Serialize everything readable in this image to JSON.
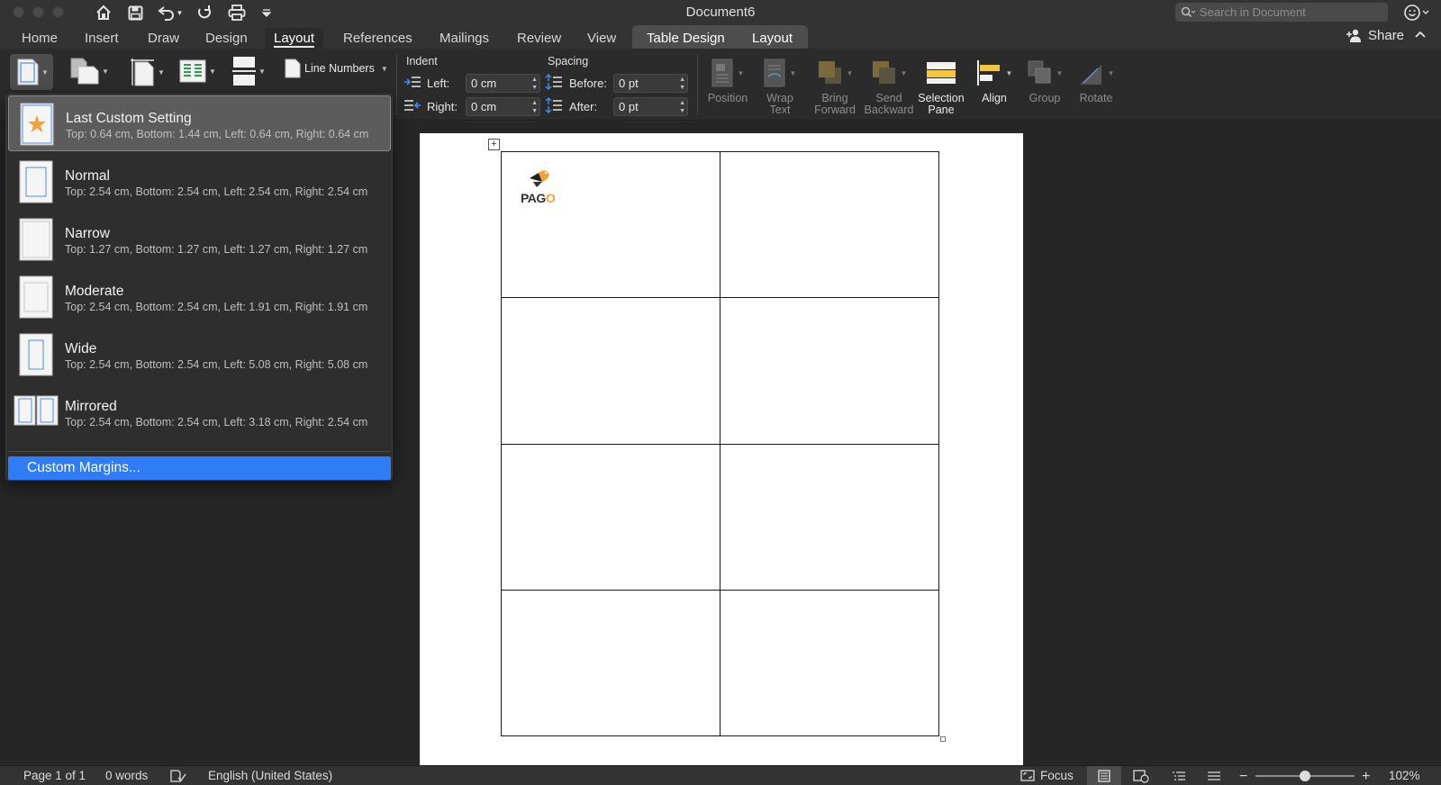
{
  "window": {
    "title": "Document6"
  },
  "search": {
    "placeholder": "Search in Document"
  },
  "tabs": [
    {
      "label": "Home"
    },
    {
      "label": "Insert"
    },
    {
      "label": "Draw"
    },
    {
      "label": "Design"
    },
    {
      "label": "Layout"
    },
    {
      "label": "References"
    },
    {
      "label": "Mailings"
    },
    {
      "label": "Review"
    },
    {
      "label": "View"
    },
    {
      "label": "Table Design"
    },
    {
      "label": "Layout"
    }
  ],
  "share": {
    "label": "Share"
  },
  "ribbon": {
    "line_numbers": "Line Numbers",
    "indent": {
      "title": "Indent",
      "left_label": "Left:",
      "left_value": "0 cm",
      "right_label": "Right:",
      "right_value": "0 cm"
    },
    "spacing": {
      "title": "Spacing",
      "before_label": "Before:",
      "before_value": "0 pt",
      "after_label": "After:",
      "after_value": "0 pt"
    },
    "arrange": {
      "position": "Position",
      "wrap_1": "Wrap",
      "wrap_2": "Text",
      "bring_1": "Bring",
      "bring_2": "Forward",
      "send_1": "Send",
      "send_2": "Backward",
      "sel_1": "Selection",
      "sel_2": "Pane",
      "align": "Align",
      "group": "Group",
      "rotate": "Rotate"
    }
  },
  "margins_menu": {
    "options": [
      {
        "name": "Last Custom Setting",
        "desc": "Top: 0.64 cm, Bottom: 1.44 cm, Left: 0.64 cm, Right: 0.64 cm"
      },
      {
        "name": "Normal",
        "desc": "Top: 2.54 cm, Bottom: 2.54 cm, Left: 2.54 cm, Right: 2.54 cm"
      },
      {
        "name": "Narrow",
        "desc": "Top: 1.27 cm, Bottom: 1.27 cm, Left: 1.27 cm, Right: 1.27 cm"
      },
      {
        "name": "Moderate",
        "desc": "Top: 2.54 cm, Bottom: 2.54 cm, Left: 1.91 cm, Right: 1.91 cm"
      },
      {
        "name": "Wide",
        "desc": "Top: 2.54 cm, Bottom: 2.54 cm, Left: 5.08 cm, Right: 5.08 cm"
      },
      {
        "name": "Mirrored",
        "desc": "Top: 2.54 cm, Bottom: 2.54 cm, Left: 3.18 cm, Right: 2.54 cm"
      }
    ],
    "custom": "Custom Margins..."
  },
  "document": {
    "logo_text_a": "PAG",
    "logo_text_b": "O"
  },
  "status": {
    "page": "Page 1 of 1",
    "words": "0 words",
    "language": "English (United States)",
    "focus": "Focus",
    "zoom": "102%"
  },
  "colors": {
    "accent": "#2f7cf6",
    "star": "#f2a236",
    "logo_orange": "#f2a236"
  }
}
